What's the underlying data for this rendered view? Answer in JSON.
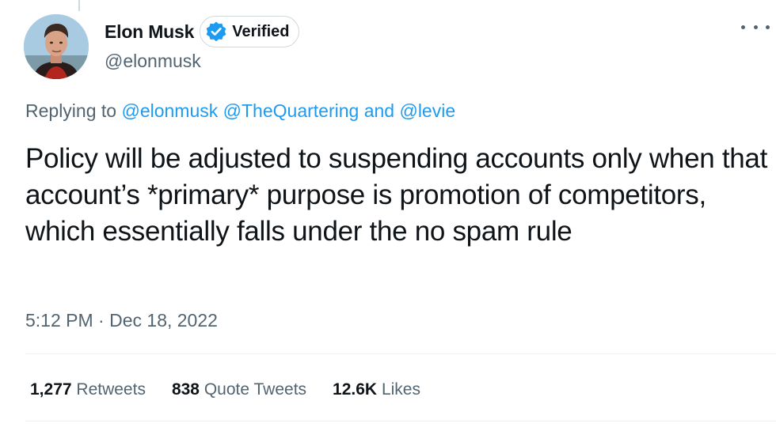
{
  "author": {
    "display_name": "Elon Musk",
    "verified_label": "Verified",
    "handle": "@elonmusk"
  },
  "replying": {
    "prefix": "Replying to",
    "mentions": [
      "@elonmusk",
      "@TheQuartering"
    ],
    "conjunction": "and",
    "last_mention": "@levie"
  },
  "tweet": {
    "text": "Policy will be adjusted to suspending accounts only when that account’s *primary* purpose is promotion of competitors, which essentially falls under the no spam rule",
    "time": "5:12 PM",
    "separator": "·",
    "date": "Dec 18, 2022"
  },
  "stats": [
    {
      "count": "1,277",
      "label": "Retweets"
    },
    {
      "count": "838",
      "label": "Quote Tweets"
    },
    {
      "count": "12.6K",
      "label": "Likes"
    }
  ],
  "icons": {
    "verified": "verified-badge-icon",
    "more": "more-options-icon"
  },
  "colors": {
    "link": "#1d9bf0",
    "secondary_text": "#536471",
    "primary_text": "#0f1419"
  }
}
